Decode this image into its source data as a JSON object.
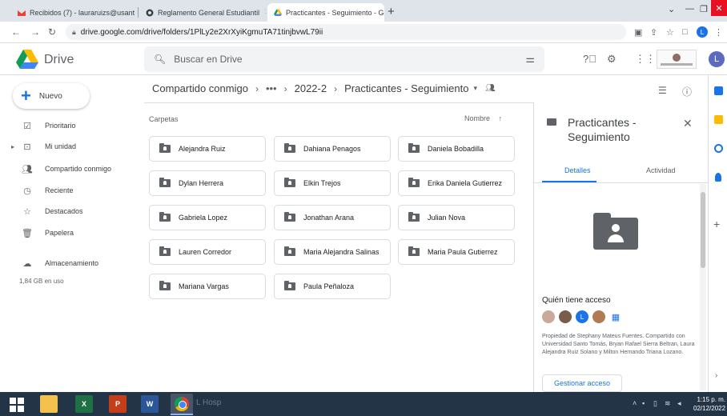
{
  "browser": {
    "tabs": [
      {
        "title": "Recibidos (7) - lauraruizs@usant",
        "active": false
      },
      {
        "title": "Reglamento General Estudiantil",
        "active": false
      },
      {
        "title": "Practicantes - Seguimiento - Goo",
        "active": true
      }
    ],
    "new_tab_label": "+",
    "url": "drive.google.com/drive/folders/1PlLy2e2XrXyiKgmuTA71tinjbvwL79ii",
    "profile_initial": "L"
  },
  "drive": {
    "app_name": "Drive",
    "search_placeholder": "Buscar en Drive",
    "user_initial": "L",
    "new_button_label": "Nuevo",
    "nav": [
      {
        "label": "Prioritario",
        "icon": "priority-icon"
      },
      {
        "label": "Mi unidad",
        "icon": "my-drive-icon"
      },
      {
        "label": "Compartido conmigo",
        "icon": "shared-icon"
      },
      {
        "label": "Reciente",
        "icon": "recent-icon"
      },
      {
        "label": "Destacados",
        "icon": "star-icon"
      },
      {
        "label": "Papelera",
        "icon": "trash-icon"
      },
      {
        "label": "Almacenamiento",
        "icon": "cloud-icon"
      }
    ],
    "storage_used": "1,84 GB en uso",
    "breadcrumb": {
      "root": "Compartido conmigo",
      "ellipsis": "•••",
      "level1": "2022-2",
      "current": "Practicantes - Seguimiento"
    },
    "section_label": "Carpetas",
    "sort_label": "Nombre",
    "folders": [
      "Alejandra Ruiz",
      "Dahiana Penagos",
      "Daniela Bobadilla",
      "Dylan Herrera",
      "Elkin Trejos",
      "Erika Daniela Gutierrez",
      "Gabriela Lopez",
      "Jonathan Arana",
      "Julian Nova",
      "Lauren Corredor",
      "Maria Alejandra Salinas",
      "Maria Paula Gutierrez",
      "Mariana Vargas",
      "Paula Peñaloza"
    ]
  },
  "details": {
    "title": "Practicantes - Seguimiento",
    "tab_details": "Detalles",
    "tab_activity": "Actividad",
    "access_title": "Quién tiene acceso",
    "access_initial": "L",
    "access_text": "Propiedad de Stephany Mateus Fuentes. Compartido con Universidad Santo Tomás, Bryan Rafael Sierra Beltran, Laura Alejandra Ruiz Solano y Milton Hernando Triana Lozano.",
    "manage_button": "Gestionar acceso"
  },
  "taskbar": {
    "ghost_text": "L Hosp",
    "clock_time": "1:15 p. m.",
    "clock_date": "02/12/2022"
  },
  "colors": {
    "accent": "#1a73e8",
    "taskbar": "#243447"
  }
}
